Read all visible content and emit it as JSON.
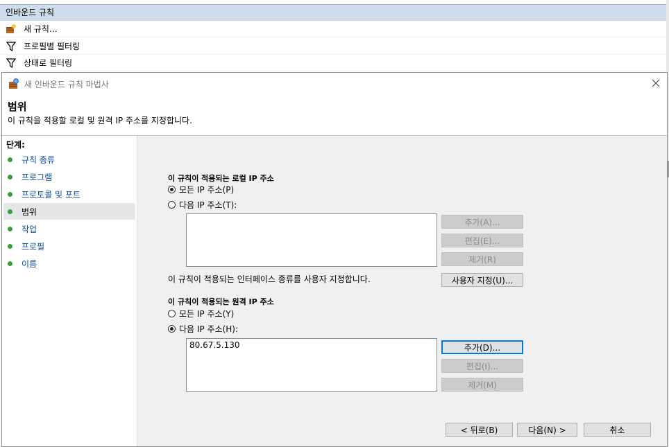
{
  "background": {
    "section_header": "인바운드 규칙",
    "actions": [
      {
        "label": "새 규칙...",
        "icon": "new-rule-icon"
      },
      {
        "label": "프로필별 필터링",
        "icon": "filter-icon"
      },
      {
        "label": "상태로 필터링",
        "icon": "filter-icon"
      }
    ]
  },
  "dialog": {
    "title": "새 인바운드 규칙 마법사",
    "heading": "범위",
    "description": "이 규칙을 적용할 로컬 및 원격 IP 주소를 지정합니다.",
    "steps_title": "단계:",
    "steps": [
      {
        "label": "규칙 종류",
        "active": false
      },
      {
        "label": "프로그램",
        "active": false
      },
      {
        "label": "프로토콜 및 포트",
        "active": false
      },
      {
        "label": "범위",
        "active": true
      },
      {
        "label": "작업",
        "active": false
      },
      {
        "label": "프로필",
        "active": false
      },
      {
        "label": "이름",
        "active": false
      }
    ],
    "local": {
      "group_label": "이 규칙이 적용되는 로컬 IP 주소",
      "any_label": "모든 IP 주소(P)",
      "specific_label": "다음 IP 주소(T):",
      "selected": "any",
      "addresses": [],
      "add_label": "추가(A)...",
      "edit_label": "편집(E)...",
      "remove_label": "제거(R)"
    },
    "interface_text": "이 규칙이 적용되는 인터페이스 종류를 사용자 지정합니다.",
    "customize_label": "사용자 지정(U)...",
    "remote": {
      "group_label": "이 규칙이 적용되는 원격 IP 주소",
      "any_label": "모든 IP 주소(Y)",
      "specific_label": "다음 IP 주소(H):",
      "selected": "specific",
      "addresses": [
        "80.67.5.130"
      ],
      "add_label": "추가(D)...",
      "edit_label": "편집(I)...",
      "remove_label": "제거(M)"
    },
    "back_label": "< 뒤로(B)",
    "next_label": "다음(N) >",
    "cancel_label": "취소"
  },
  "colors": {
    "header_bg": "#cfdcec",
    "content_bg": "#f0f0f0",
    "step_dot": "#3aa13a",
    "step_link": "#0a4a9a",
    "focus_border": "#0078d7"
  }
}
